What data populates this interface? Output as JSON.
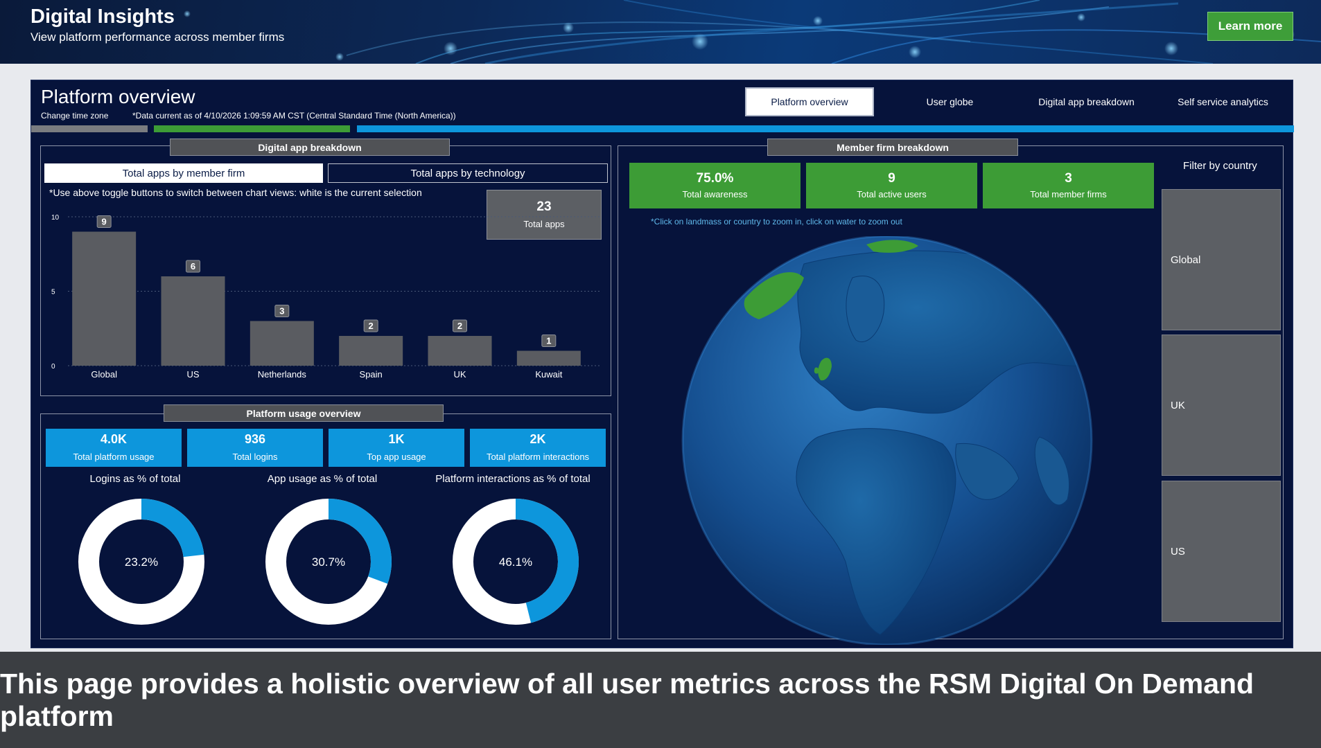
{
  "banner": {
    "title": "Digital Insights",
    "subtitle": "View platform performance across member firms",
    "learn_more": "Learn more"
  },
  "header": {
    "title": "Platform overview",
    "change_time_zone": "Change time zone",
    "data_note": "*Data current as of 4/10/2026 1:09:59 AM CST (Central Standard Time (North America))"
  },
  "tabs": [
    {
      "label": "Platform overview",
      "active": true
    },
    {
      "label": "User globe",
      "active": false
    },
    {
      "label": "Digital app breakdown",
      "active": false
    },
    {
      "label": "Self service analytics",
      "active": false
    }
  ],
  "colors": {
    "panel": "#06133b",
    "green": "#3d9c36",
    "blue": "#0d96dc",
    "gray": "#5c5f64",
    "bar": "#5a5c61"
  },
  "digital_app_breakdown": {
    "title": "Digital app breakdown",
    "toggle_on": "Total apps by member firm",
    "toggle_off": "Total apps by technology",
    "hint": "*Use above toggle buttons to switch between chart views: white is the current selection",
    "total_apps_value": "23",
    "total_apps_label": "Total apps"
  },
  "chart_data": {
    "type": "bar",
    "categories": [
      "Global",
      "US",
      "Netherlands",
      "Spain",
      "UK",
      "Kuwait"
    ],
    "values": [
      9,
      6,
      3,
      2,
      2,
      1
    ],
    "yticks": [
      0,
      5,
      10
    ],
    "ylim": [
      0,
      10
    ],
    "grid": true,
    "data_labels": true
  },
  "platform_usage": {
    "title": "Platform usage overview",
    "kpis": [
      {
        "value": "4.0K",
        "label": "Total platform usage"
      },
      {
        "value": "936",
        "label": "Total logins"
      },
      {
        "value": "1K",
        "label": "Top app usage"
      },
      {
        "value": "2K",
        "label": "Total platform interactions"
      }
    ],
    "donuts": [
      {
        "title": "Logins as % of total",
        "label": "23.2%",
        "value": 0.232
      },
      {
        "title": "App usage as % of total",
        "label": "30.7%",
        "value": 0.307
      },
      {
        "title": "Platform interactions as % of total",
        "label": "46.1%",
        "value": 0.461
      }
    ]
  },
  "member_firm": {
    "title": "Member firm breakdown",
    "kpis": [
      {
        "value": "75.0%",
        "label": "Total awareness"
      },
      {
        "value": "9",
        "label": "Total active users"
      },
      {
        "value": "3",
        "label": "Total member firms"
      }
    ],
    "globe_note": "*Click on landmass or country to zoom in, click on water to zoom out",
    "filter_title": "Filter by country",
    "filters": [
      "Global",
      "UK",
      "US"
    ]
  },
  "caption": "This page provides a holistic overview of all user metrics across the RSM Digital On Demand platform"
}
